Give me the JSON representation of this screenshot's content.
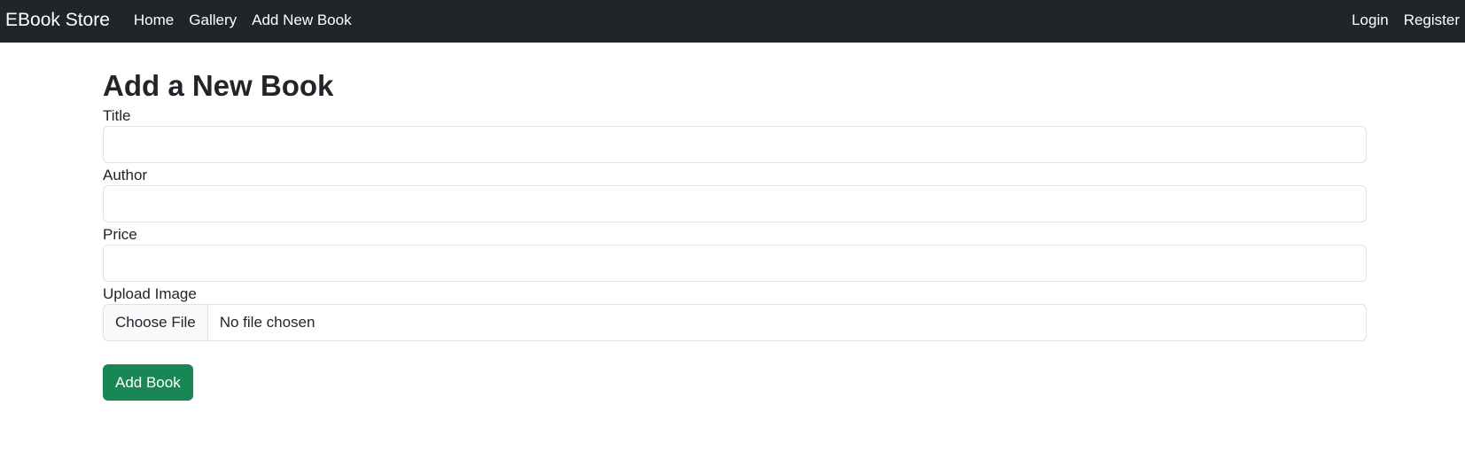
{
  "navbar": {
    "brand": "EBook Store",
    "links": [
      "Home",
      "Gallery",
      "Add New Book"
    ],
    "right_links": [
      "Login",
      "Register"
    ]
  },
  "page": {
    "title": "Add a New Book"
  },
  "form": {
    "title_label": "Title",
    "title_value": "",
    "author_label": "Author",
    "author_value": "",
    "price_label": "Price",
    "price_value": "",
    "image_label": "Upload Image",
    "file_button": "Choose File",
    "file_status": "No file chosen",
    "submit_label": "Add Book"
  },
  "colors": {
    "navbar_bg": "#212529",
    "submit_bg": "#198754"
  }
}
